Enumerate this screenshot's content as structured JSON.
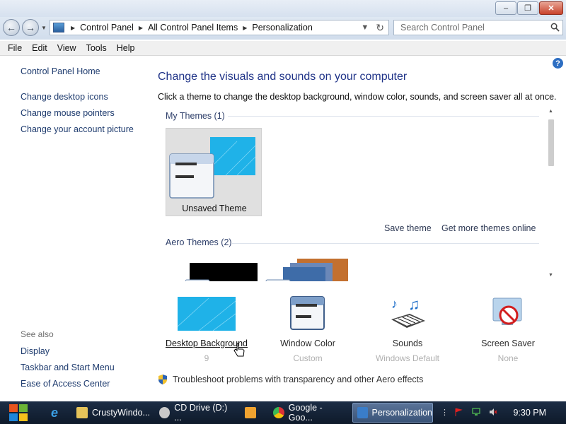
{
  "window": {
    "minimize": "–",
    "restore": "❐",
    "close": "✕"
  },
  "address": {
    "crumbs": [
      "Control Panel",
      "All Control Panel Items",
      "Personalization"
    ],
    "search_placeholder": "Search Control Panel"
  },
  "menu": [
    "File",
    "Edit",
    "View",
    "Tools",
    "Help"
  ],
  "left": {
    "home": "Control Panel Home",
    "links": [
      "Change desktop icons",
      "Change mouse pointers",
      "Change your account picture"
    ],
    "see_also": "See also",
    "see_also_links": [
      "Display",
      "Taskbar and Start Menu",
      "Ease of Access Center"
    ]
  },
  "main": {
    "title": "Change the visuals and sounds on your computer",
    "subtitle": "Click a theme to change the desktop background, window color, sounds, and screen saver all at once.",
    "my_themes": "My Themes (1)",
    "unsaved_theme": "Unsaved Theme",
    "save_theme": "Save theme",
    "get_more": "Get more themes online",
    "aero_themes": "Aero Themes (2)"
  },
  "tiles": [
    {
      "name": "Desktop Background",
      "sub": "9"
    },
    {
      "name": "Window Color",
      "sub": "Custom"
    },
    {
      "name": "Sounds",
      "sub": "Windows Default"
    },
    {
      "name": "Screen Saver",
      "sub": "None"
    }
  ],
  "troubleshoot": "Troubleshoot problems with transparency and other Aero effects",
  "taskbar": {
    "items": [
      "CrustyWindo...",
      "CD Drive (D:) ...",
      "Google - Goo...",
      "Personalization"
    ],
    "clock": "9:30 PM"
  },
  "colors": {
    "accent_blue": "#1e3287",
    "link": "#1e3b6e",
    "theme_cyan": "#1fb2e8"
  }
}
